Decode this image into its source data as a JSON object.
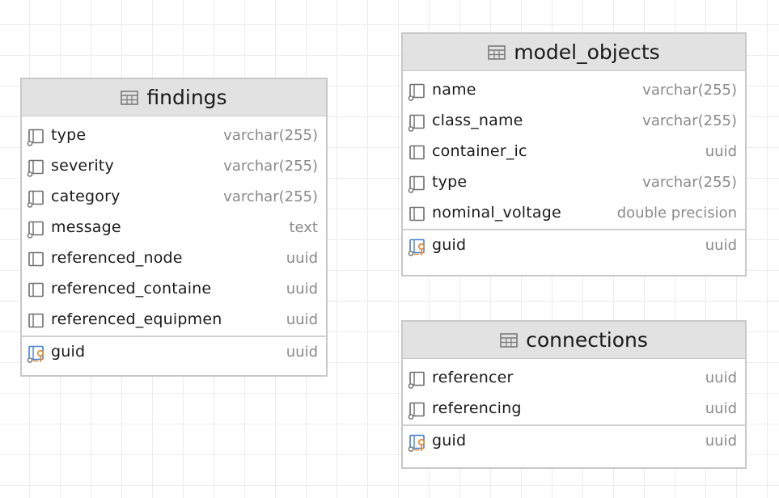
{
  "tables": {
    "findings": {
      "title": "findings",
      "columns": [
        {
          "name": "type",
          "type": "varchar(255)"
        },
        {
          "name": "severity",
          "type": "varchar(255)"
        },
        {
          "name": "category",
          "type": "varchar(255)"
        },
        {
          "name": "message",
          "type": "text"
        },
        {
          "name": "referenced_node",
          "type": "uuid"
        },
        {
          "name": "referenced_containe",
          "type": "uuid"
        },
        {
          "name": "referenced_equipmen",
          "type": "uuid"
        }
      ],
      "key": {
        "name": "guid",
        "type": "uuid"
      }
    },
    "model_objects": {
      "title": "model_objects",
      "columns": [
        {
          "name": "name",
          "type": "varchar(255)"
        },
        {
          "name": "class_name",
          "type": "varchar(255)"
        },
        {
          "name": "container_ic",
          "type": "uuid"
        },
        {
          "name": "type",
          "type": "varchar(255)"
        },
        {
          "name": "nominal_voltage",
          "type": "double precision"
        }
      ],
      "key": {
        "name": "guid",
        "type": "uuid"
      }
    },
    "connections": {
      "title": "connections",
      "columns": [
        {
          "name": "referencer",
          "type": "uuid"
        },
        {
          "name": "referencing",
          "type": "uuid"
        }
      ],
      "key": {
        "name": "guid",
        "type": "uuid"
      }
    }
  }
}
